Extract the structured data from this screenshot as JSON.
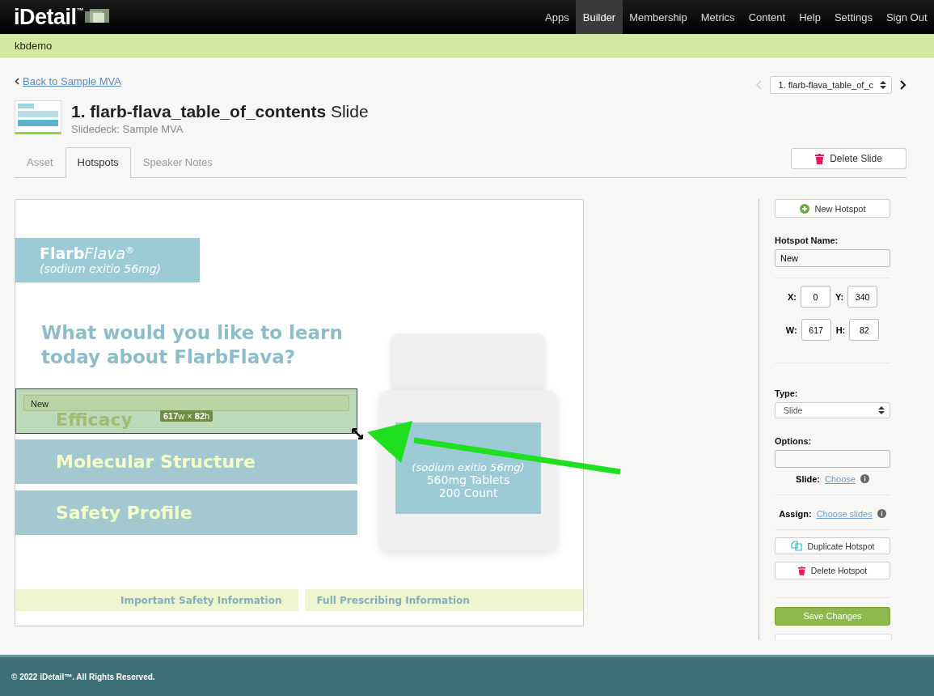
{
  "nav": {
    "brand": "iDetail",
    "brand_mark": "™",
    "items": [
      {
        "label": "Apps",
        "selected": false
      },
      {
        "label": "Builder",
        "selected": true
      },
      {
        "label": "Membership",
        "selected": false
      },
      {
        "label": "Metrics",
        "selected": false
      },
      {
        "label": "Content",
        "selected": false
      },
      {
        "label": "Help",
        "selected": false
      },
      {
        "label": "Settings",
        "selected": false
      },
      {
        "label": "Sign Out",
        "selected": false
      }
    ]
  },
  "account": "kbdemo",
  "back_link": "Back to Sample MVA",
  "slide_picker": {
    "value": "1. flarb-flava_table_of_c"
  },
  "title": {
    "name": "1. flarb-flava_table_of_contents",
    "suffix": "Slide",
    "subtitle": "Slidedeck: Sample MVA"
  },
  "tabs": [
    {
      "label": "Asset",
      "selected": false
    },
    {
      "label": "Hotspots",
      "selected": true
    },
    {
      "label": "Speaker Notes",
      "selected": false
    }
  ],
  "delete_slide": "Delete Slide",
  "slide": {
    "brand": "Flarb",
    "brand_light": "Flava",
    "brand_mark": "®",
    "brand_sub": "(sodium exitio 56mg)",
    "heading": "What would you like to learn today about FlarbFlava?",
    "menu": [
      "Efficacy",
      "Molecular Structure",
      "Safety Profile"
    ],
    "label_sub": "(sodium exitio 56mg)",
    "label_lines": [
      "560mg Tablets",
      "200 Count"
    ],
    "links": [
      "Important Safety Information",
      "Full Prescribing Information"
    ]
  },
  "hotspot": {
    "name": "New",
    "size": "**617**w × **82**h"
  },
  "panel": {
    "new_hotspot": "New Hotspot",
    "name_label": "Hotspot Name:",
    "name_value": "New",
    "coords": [
      [
        {
          "label": "X:",
          "value": "0"
        },
        {
          "label": "Y:",
          "value": "340"
        }
      ],
      [
        {
          "label": "W:",
          "value": "617"
        },
        {
          "label": "H:",
          "value": "82"
        }
      ]
    ],
    "type_label": "Type:",
    "type_value": "Slide",
    "options_label": "Options:",
    "slide_label": "Slide:",
    "slide_link": "Choose",
    "assign_label": "Assign:",
    "assign_link": "Choose slides",
    "duplicate": "Duplicate Hotspot",
    "delete": "Delete Hotspot",
    "save": "Save Changes"
  },
  "footer": "© 2022 iDetail™.  All Rights Reserved."
}
